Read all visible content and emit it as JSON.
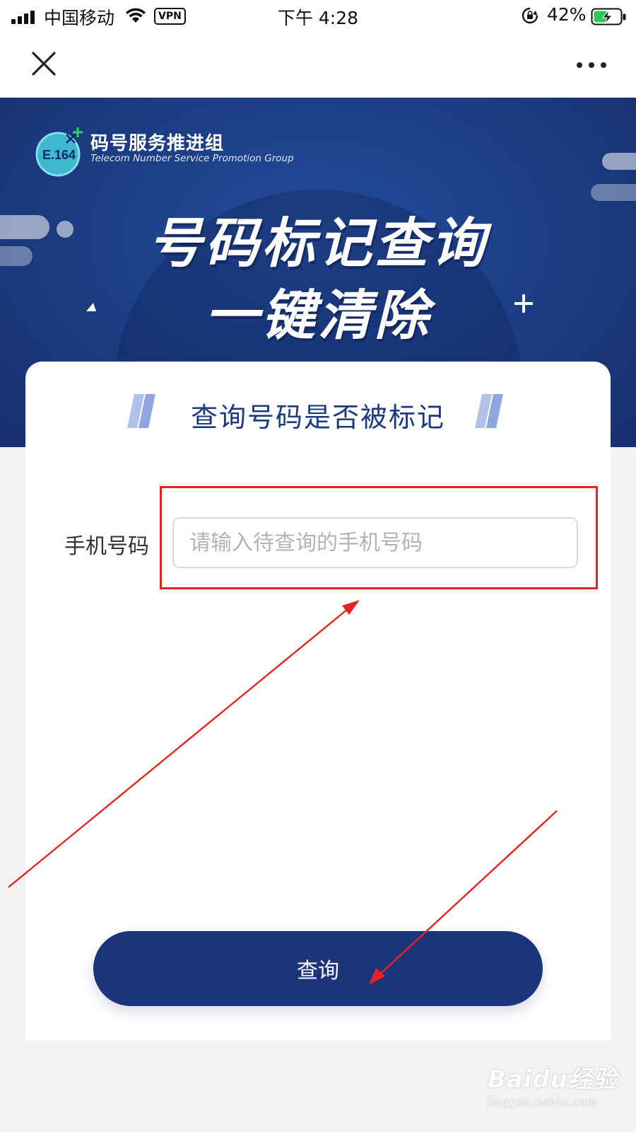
{
  "status_bar": {
    "carrier": "中国移动",
    "vpn": "VPN",
    "time": "下午 4:28",
    "battery": "42%"
  },
  "banner": {
    "org_name_cn": "码号服务推进组",
    "org_name_en": "Telecom Number Service  Promotion Group",
    "logo_text": "E.164",
    "headline_line1": "号码标记查询",
    "headline_line2": "一键清除",
    "background_color": "#1d3f87"
  },
  "card": {
    "title": "查询号码是否被标记",
    "phone_label": "手机号码",
    "phone_placeholder": "请输入待查询的手机号码",
    "phone_value": "",
    "query_button": "查询"
  },
  "annotation": {
    "color": "#e8231f"
  },
  "watermark": {
    "brand": "Baidu经验",
    "url": "jingyan.baidu.com"
  },
  "colors": {
    "primary": "#1b357a",
    "page_bg": "#f3f2f3",
    "card_title": "#1b3a7f"
  }
}
